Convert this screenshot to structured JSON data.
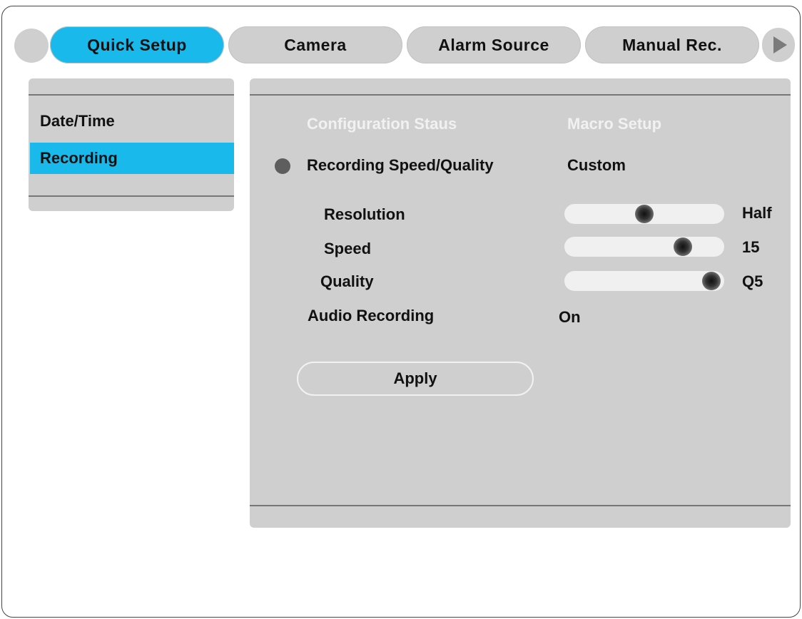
{
  "tabs": [
    {
      "label": "Quick Setup",
      "active": true
    },
    {
      "label": "Camera",
      "active": false
    },
    {
      "label": "Alarm Source",
      "active": false
    },
    {
      "label": "Manual Rec.",
      "active": false
    }
  ],
  "left_menu": {
    "items": [
      {
        "label": "Date/Time",
        "selected": false
      },
      {
        "label": "Recording",
        "selected": true
      }
    ]
  },
  "main": {
    "header_left": "Configuration Staus",
    "header_right": "Macro Setup",
    "recording_speed_quality": {
      "label": "Recording Speed/Quality",
      "value": "Custom"
    },
    "resolution": {
      "label": "Resolution",
      "value": "Half",
      "level": 0.5
    },
    "speed": {
      "label": "Speed",
      "value": "15",
      "level": 0.74
    },
    "quality": {
      "label": "Quality",
      "value": "Q5",
      "level": 0.92
    },
    "audio_recording": {
      "label": "Audio Recording",
      "value": "On"
    },
    "apply_label": "Apply"
  },
  "colors": {
    "accent": "#19b9ec",
    "panel": "#cfcfcf"
  },
  "icons": {
    "next_tab": "triangle-right-icon",
    "bullet": "radio-bullet-icon",
    "slider_knob": "slider-knob-icon"
  }
}
